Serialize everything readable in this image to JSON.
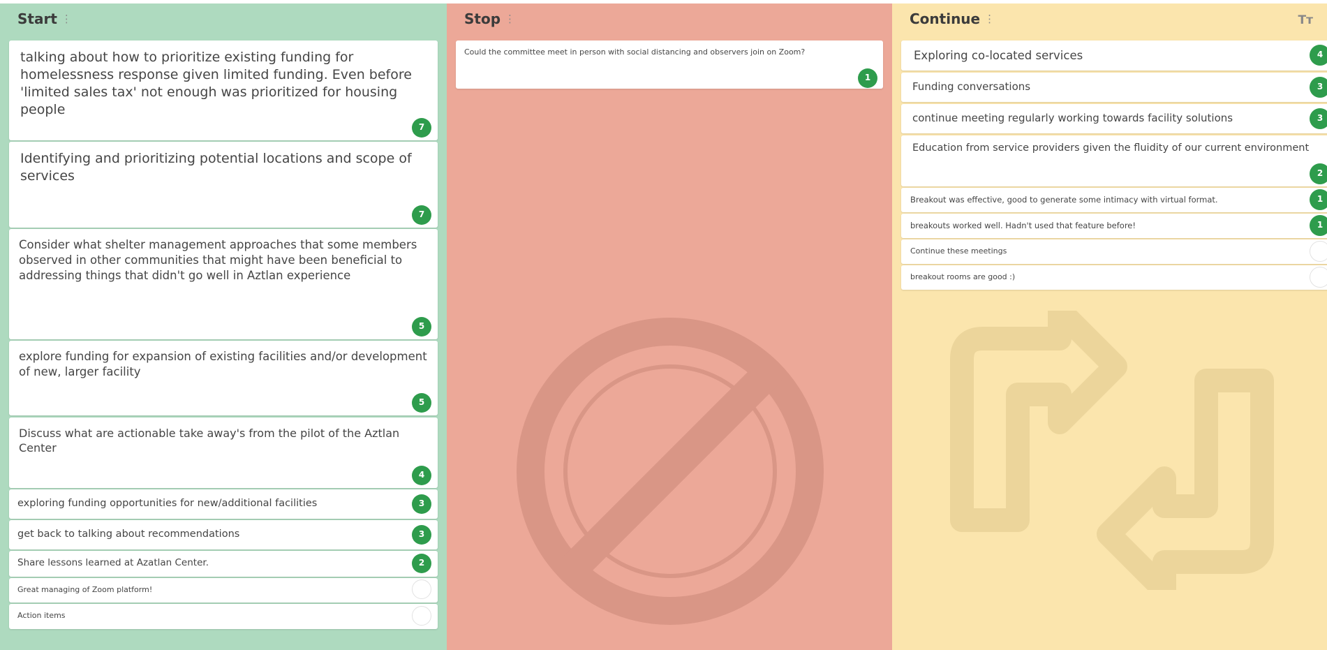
{
  "columns": {
    "start": {
      "title": "Start",
      "cards": [
        {
          "text": "talking about how to prioritize existing funding for homelessness response given limited funding. Even before 'limited sales tax' not enough was prioritized for housing people",
          "votes": "7"
        },
        {
          "text": "Identifying and prioritizing potential locations and scope of services",
          "votes": "7"
        },
        {
          "text": "Consider what shelter management approaches that some members observed in other communities that might have been beneficial to addressing things that didn't go well in Aztlan experience",
          "votes": "5"
        },
        {
          "text": "explore funding for expansion of existing facilities and/or development of new, larger facility",
          "votes": "5"
        },
        {
          "text": "Discuss what are actionable take away's from the pilot of the Aztlan Center",
          "votes": "4"
        },
        {
          "text": "exploring funding opportunities for new/additional facilities",
          "votes": "3"
        },
        {
          "text": "get back to talking about recommendations",
          "votes": "3"
        },
        {
          "text": "Share lessons learned at Azatlan Center.",
          "votes": "2"
        },
        {
          "text": "Great managing of Zoom platform!",
          "votes": ""
        },
        {
          "text": "Action items",
          "votes": ""
        }
      ]
    },
    "stop": {
      "title": "Stop",
      "cards": [
        {
          "text": "Could the committee meet in person with social distancing and observers join on Zoom?",
          "votes": "1"
        }
      ]
    },
    "continue": {
      "title": "Continue",
      "font_icon": "Tт",
      "cards": [
        {
          "text": "Exploring co-located services",
          "votes": "4"
        },
        {
          "text": "Funding conversations",
          "votes": "3"
        },
        {
          "text": "continue meeting regularly working towards facility solutions",
          "votes": "3"
        },
        {
          "text": "Education from service providers given the fluidity of our current environment",
          "votes": "2"
        },
        {
          "text": "Breakout was effective, good to generate some intimacy with virtual format.",
          "votes": "1"
        },
        {
          "text": "breakouts worked well. Hadn't used that feature before!",
          "votes": "1"
        },
        {
          "text": "Continue these meetings",
          "votes": ""
        },
        {
          "text": "breakout rooms are good :)",
          "votes": ""
        }
      ]
    }
  },
  "icons": {
    "column_drag": "drag-handle-icon",
    "stop_watermark": "no-entry-icon",
    "continue_watermark": "repeat-arrows-icon",
    "font_size": "text-size-icon"
  },
  "colors": {
    "start_bg": "#aedabf",
    "stop_bg": "#eca898",
    "continue_bg": "#fbe5ad",
    "vote_badge": "#2e9c4c"
  }
}
